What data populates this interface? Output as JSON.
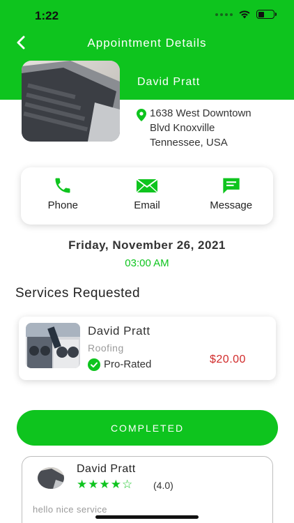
{
  "status_bar": {
    "time": "1:22"
  },
  "header": {
    "title": "Appointment Details"
  },
  "provider": {
    "name": "David Pratt",
    "address_lines": [
      "1638 West Downtown",
      "Blvd Knoxville",
      "Tennessee, USA"
    ]
  },
  "contact": {
    "phone_label": "Phone",
    "email_label": "Email",
    "message_label": "Message"
  },
  "appointment": {
    "date": "Friday, November 26, 2021",
    "time": "03:00 AM"
  },
  "services": {
    "title": "Services Requested",
    "item": {
      "name": "David Pratt",
      "category": "Roofing",
      "badge": "Pro-Rated",
      "price": "$20.00"
    }
  },
  "status_button": {
    "label": "COMPLETED"
  },
  "review": {
    "name": "David Pratt",
    "rating": 4,
    "rating_text": "(4.0)",
    "text": "hello nice service"
  },
  "colors": {
    "accent": "#0ec41e",
    "price": "#d12a2a"
  },
  "icons": [
    "back-arrow-icon",
    "location-pin-icon",
    "phone-icon",
    "email-icon",
    "message-icon",
    "check-circle-icon",
    "star-icon"
  ]
}
